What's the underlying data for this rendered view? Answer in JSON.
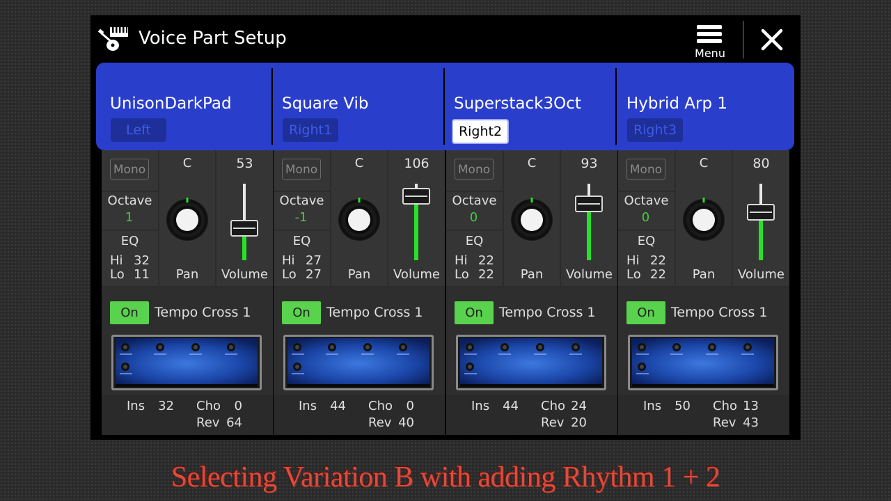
{
  "window": {
    "title": "Voice Part Setup",
    "menu_label": "Menu"
  },
  "parts": [
    {
      "voice": "UnisonDarkPad",
      "part": "Left",
      "selected": false,
      "mono": "Mono",
      "pan": "C",
      "volume": 53,
      "octave_label": "Octave",
      "octave": "1",
      "eq_label": "EQ",
      "eq_hi_label": "Hi",
      "eq_hi": "32",
      "eq_lo_label": "Lo",
      "eq_lo": "11",
      "pan_label": "Pan",
      "volume_label": "Volume",
      "effect_on": "On",
      "effect": "Tempo Cross 1",
      "ins_label": "Ins",
      "ins": "32",
      "cho_label": "Cho",
      "cho": "0",
      "rev_label": "Rev",
      "rev": "64"
    },
    {
      "voice": "Square Vib",
      "part": "Right1",
      "selected": false,
      "mono": "Mono",
      "pan": "C",
      "volume": 106,
      "octave_label": "Octave",
      "octave": "-1",
      "eq_label": "EQ",
      "eq_hi_label": "Hi",
      "eq_hi": "27",
      "eq_lo_label": "Lo",
      "eq_lo": "27",
      "pan_label": "Pan",
      "volume_label": "Volume",
      "effect_on": "On",
      "effect": "Tempo Cross 1",
      "ins_label": "Ins",
      "ins": "44",
      "cho_label": "Cho",
      "cho": "0",
      "rev_label": "Rev",
      "rev": "40"
    },
    {
      "voice": "Superstack3Oct",
      "part": "Right2",
      "selected": true,
      "mono": "Mono",
      "pan": "C",
      "volume": 93,
      "octave_label": "Octave",
      "octave": "0",
      "eq_label": "EQ",
      "eq_hi_label": "Hi",
      "eq_hi": "22",
      "eq_lo_label": "Lo",
      "eq_lo": "22",
      "pan_label": "Pan",
      "volume_label": "Volume",
      "effect_on": "On",
      "effect": "Tempo Cross 1",
      "ins_label": "Ins",
      "ins": "44",
      "cho_label": "Cho",
      "cho": "24",
      "rev_label": "Rev",
      "rev": "20"
    },
    {
      "voice": "Hybrid Arp 1",
      "part": "Right3",
      "selected": false,
      "mono": "Mono",
      "pan": "C",
      "volume": 80,
      "octave_label": "Octave",
      "octave": "0",
      "eq_label": "EQ",
      "eq_hi_label": "Hi",
      "eq_hi": "22",
      "eq_lo_label": "Lo",
      "eq_lo": "22",
      "pan_label": "Pan",
      "volume_label": "Volume",
      "effect_on": "On",
      "effect": "Tempo Cross 1",
      "ins_label": "Ins",
      "ins": "50",
      "cho_label": "Cho",
      "cho": "13",
      "rev_label": "Rev",
      "rev": "43"
    }
  ],
  "caption": "Selecting Variation B with adding Rhythm 1 + 2",
  "icons": {
    "app": "keyboard-guitar-icon",
    "menu": "hamburger-menu-icon",
    "close": "close-icon",
    "knob": "pan-knob-icon",
    "effect": "effect-unit-image"
  },
  "colors": {
    "part_header": "#2a3ecc",
    "on_button": "#59d24d",
    "value_green": "#3ed13e",
    "fader_green": "#29e029",
    "caption": "#e14a3a"
  }
}
